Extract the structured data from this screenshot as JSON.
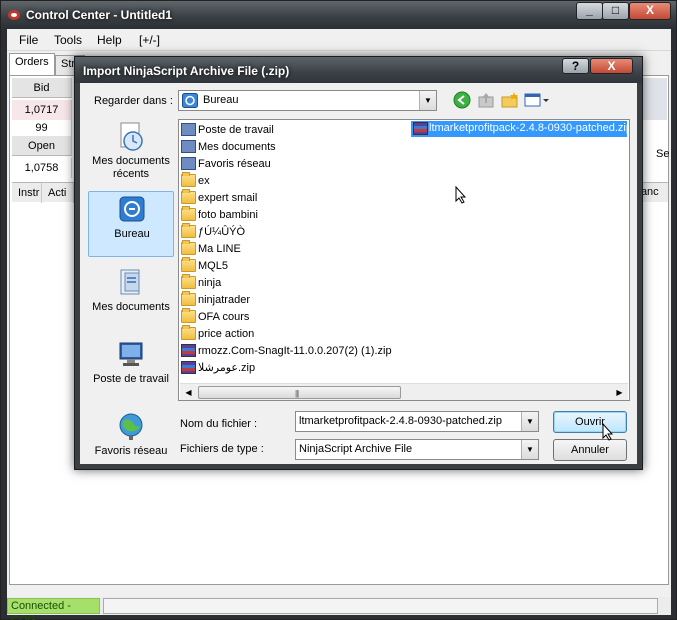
{
  "main_window": {
    "title": "Control Center - Untitled1",
    "caption_min": "_",
    "caption_max": "□",
    "caption_close": "X"
  },
  "menu": {
    "file": "File",
    "tools": "Tools",
    "help": "Help",
    "plusminus": "[+/-]"
  },
  "tabs": {
    "orders": "Orders",
    "strategies": "Strat"
  },
  "grid": {
    "bid_header": "Bid",
    "bid_price": "1,0717",
    "bid_size": "99",
    "open_header": "Open",
    "open_value": "1,0758",
    "instr_header": "Instr",
    "acti_header": "Acti",
    "right_cancel": "Canc",
    "right_se": "Se"
  },
  "status": {
    "connected": "Connected - CQG"
  },
  "dialog": {
    "title": "Import NinjaScript Archive File (.zip)",
    "help_btn": "?",
    "close_btn": "X",
    "look_in_label": "Regarder dans :",
    "look_in_value": "Bureau",
    "places": {
      "recent": "Mes documents récents",
      "desktop": "Bureau",
      "documents": "Mes documents",
      "computer": "Poste de travail",
      "network": "Favoris réseau"
    },
    "files": [
      {
        "name": "Poste de travail",
        "icon": "computer-icon"
      },
      {
        "name": "Mes documents",
        "icon": "documents-icon"
      },
      {
        "name": "Favoris réseau",
        "icon": "network-icon"
      },
      {
        "name": "ex",
        "icon": "folder-icon"
      },
      {
        "name": "expert smail",
        "icon": "folder-icon"
      },
      {
        "name": "foto bambini",
        "icon": "folder-icon"
      },
      {
        "name": "ƒÚ¼ÛÝÒ",
        "icon": "folder-icon"
      },
      {
        "name": "Ma LINE",
        "icon": "folder-icon"
      },
      {
        "name": "MQL5",
        "icon": "folder-icon"
      },
      {
        "name": "ninja",
        "icon": "folder-icon"
      },
      {
        "name": "ninjatrader",
        "icon": "folder-icon"
      },
      {
        "name": "OFA cours",
        "icon": "folder-icon"
      },
      {
        "name": "price action",
        "icon": "folder-icon"
      },
      {
        "name": "rmozz.Com-SnagIt-11.0.0.207(2) (1).zip",
        "icon": "archive-icon"
      },
      {
        "name": "عومرشلا.zip",
        "icon": "archive-icon"
      }
    ],
    "selected_file": "ltmarketprofitpack-2.4.8-0930-patched.zip",
    "filename_label": "Nom du fichier :",
    "filename_value": "ltmarketprofitpack-2.4.8-0930-patched.zip",
    "filetype_label": "Fichiers de type :",
    "filetype_value": "NinjaScript Archive File",
    "open_button": "Ouvrir",
    "cancel_button": "Annuler"
  }
}
